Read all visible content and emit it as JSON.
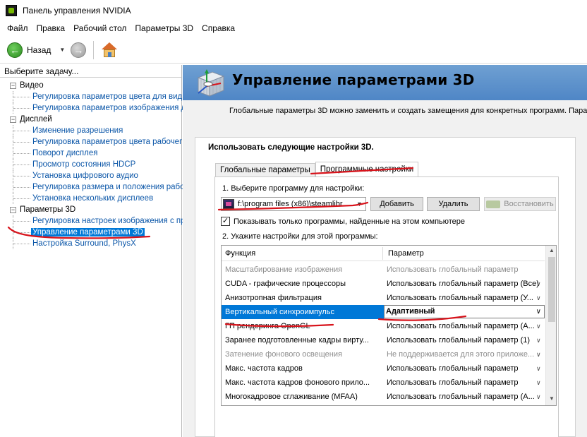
{
  "window": {
    "title": "Панель управления NVIDIA"
  },
  "menu": [
    "Файл",
    "Правка",
    "Рабочий стол",
    "Параметры 3D",
    "Справка"
  ],
  "toolbar": {
    "back_label": "Назад"
  },
  "left": {
    "header": "Выберите задачу...",
    "tree": [
      {
        "label": "Видео",
        "children": [
          "Регулировка параметров цвета для вид",
          "Регулировка параметров изображения д"
        ]
      },
      {
        "label": "Дисплей",
        "children": [
          "Изменение разрешения",
          "Регулировка параметров цвета рабочег",
          "Поворот дисплея",
          "Просмотр состояния HDCP",
          "Установка цифрового аудио",
          "Регулировка размера и положения рабо",
          "Установка нескольких дисплеев"
        ]
      },
      {
        "label": "Параметры 3D",
        "children": [
          "Регулировка настроек изображения с пр",
          "Управление параметрами 3D",
          "Настройка Surround, PhysX"
        ]
      }
    ],
    "selected": "Управление параметрами 3D"
  },
  "right": {
    "title": "Управление параметрами 3D",
    "description": "Глобальные параметры 3D можно заменить и создать замещения для конкретных программ. Пара",
    "settings_title": "Использовать следующие настройки 3D.",
    "tabs": [
      "Глобальные параметры",
      "Программные настройки"
    ],
    "active_tab": 1,
    "step1": "1. Выберите программу для настройки:",
    "program": "f:\\program files (x86)\\steamlibr...",
    "buttons": {
      "add": "Добавить",
      "remove": "Удалить",
      "restore": "Восстановить"
    },
    "checkbox_label": "Показывать только программы, найденные на этом компьютере",
    "checkbox_checked": true,
    "step2": "2. Укажите настройки для этой программы:",
    "grid": {
      "headers": [
        "Функция",
        "Параметр"
      ],
      "rows": [
        {
          "func": "Масштабирование изображения",
          "param": "Использовать глобальный параметр",
          "state": "dim"
        },
        {
          "func": "CUDA - графические процессоры",
          "param": "Использовать глобальный параметр (Все)",
          "state": "normal"
        },
        {
          "func": "Анизотропная фильтрация",
          "param": "Использовать глобальный параметр (У...",
          "state": "normal"
        },
        {
          "func": "Вертикальный синхроимпульс",
          "param": "Адаптивный",
          "state": "selected"
        },
        {
          "func": "ГП рендеринга OpenGL",
          "param": "Использовать глобальный параметр (А...",
          "state": "normal"
        },
        {
          "func": "Заранее подготовленные кадры вирту...",
          "param": "Использовать глобальный параметр (1)",
          "state": "normal"
        },
        {
          "func": "Затенение фонового освещения",
          "param": "Не поддерживается для этого приложе...",
          "state": "dim"
        },
        {
          "func": "Макс. частота кадров",
          "param": "Использовать глобальный параметр",
          "state": "normal"
        },
        {
          "func": "Макс. частота кадров фонового прило...",
          "param": "Использовать глобальный параметр",
          "state": "normal"
        },
        {
          "func": "Многокадровое сглаживание (MFAA)",
          "param": "Использовать глобальный параметр (А...",
          "state": "normal"
        }
      ]
    }
  },
  "colors": {
    "selection": "#0078d7",
    "link": "#0b56a8",
    "annotation": "#d8131b",
    "banner": "#5b8fc9"
  }
}
